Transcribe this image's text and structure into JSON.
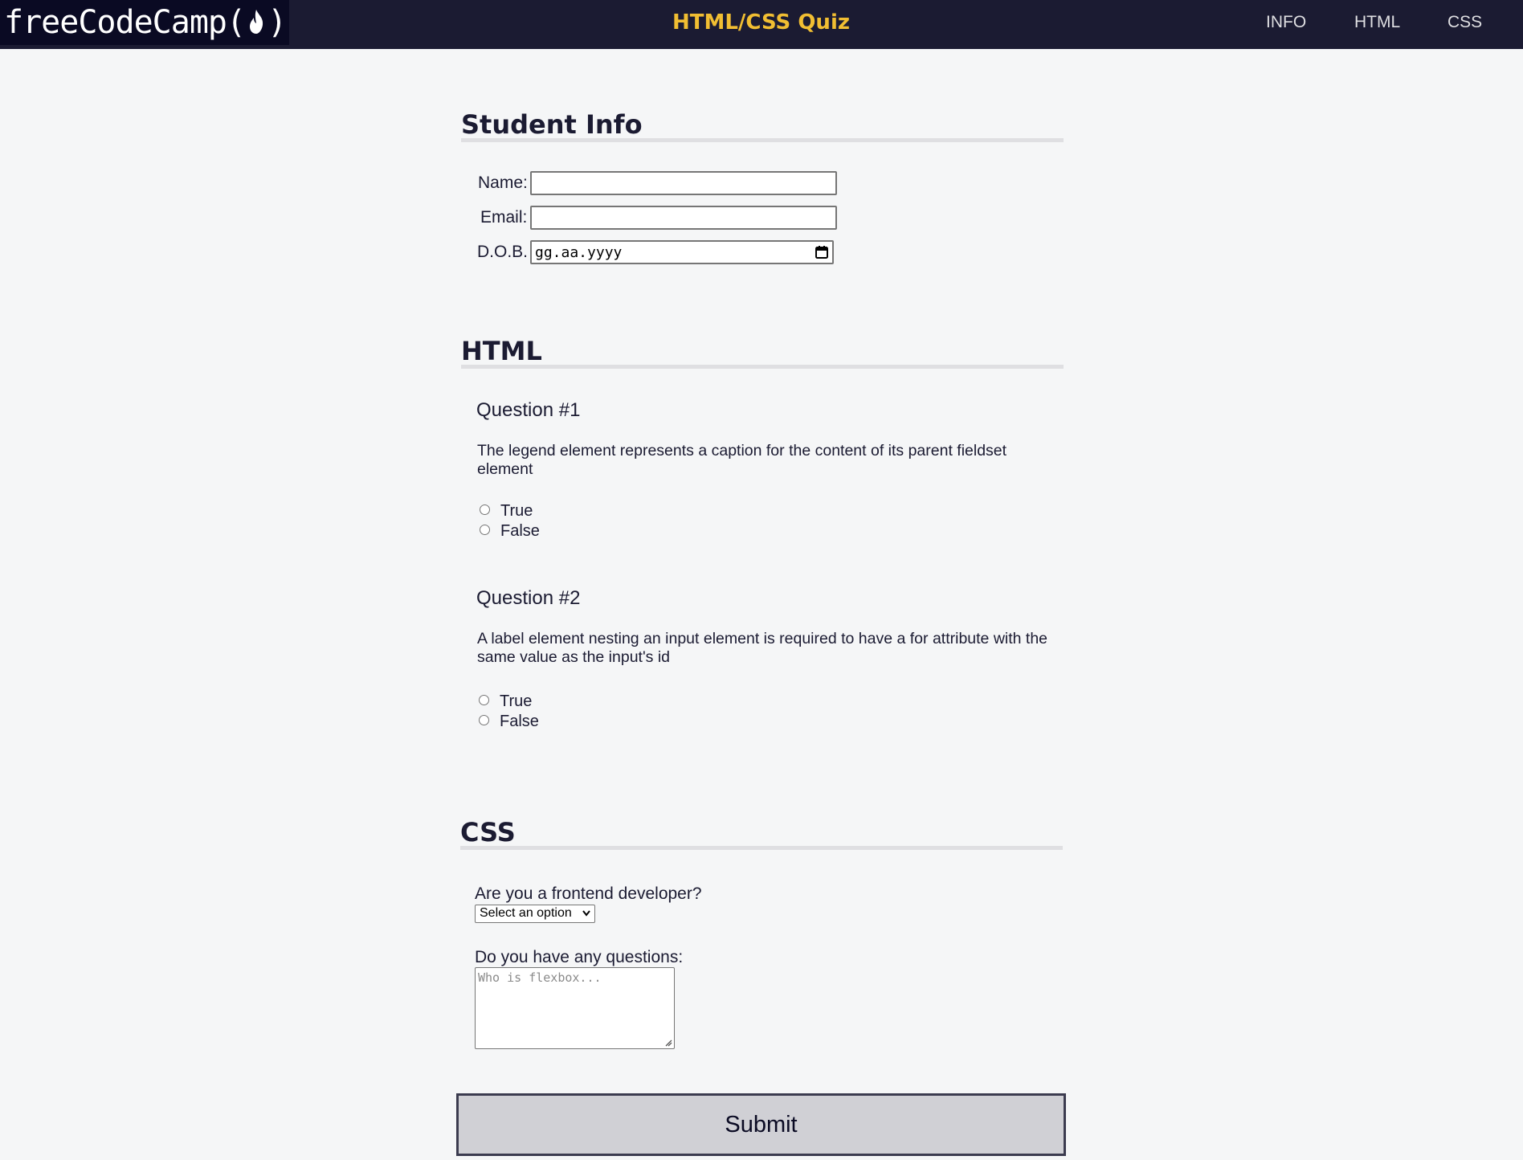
{
  "header": {
    "logo_text": "freeCodeCamp(",
    "logo_close": ")",
    "title": "HTML/CSS Quiz",
    "nav": [
      {
        "label": "INFO"
      },
      {
        "label": "HTML"
      },
      {
        "label": "CSS"
      }
    ]
  },
  "student_info": {
    "title": "Student Info",
    "name_label": "Name:",
    "name_value": "",
    "email_label": "Email:",
    "email_value": "",
    "dob_label": "D.O.B.",
    "dob_placeholder": "gg.aa.yyyy"
  },
  "html_section": {
    "title": "HTML",
    "questions": [
      {
        "title": "Question #1",
        "text": "The legend element represents a caption for the content of its parent fieldset element",
        "options": [
          "True",
          "False"
        ]
      },
      {
        "title": "Question #2",
        "text": "A label element nesting an input element is required to have a for attribute with the same value as the input's id",
        "options": [
          "True",
          "False"
        ]
      }
    ]
  },
  "css_section": {
    "title": "CSS",
    "frontend_label": "Are you a frontend developer?",
    "frontend_selected": "Select an option",
    "questions_label": "Do you have any questions:",
    "questions_placeholder": "Who is flexbox..."
  },
  "submit_label": "Submit",
  "colors": {
    "header_bg": "#1b1b32",
    "logo_bg": "#0a0a23",
    "title_accent": "#f1be32",
    "page_bg": "#f5f6f7",
    "button_bg": "#d0d0d5"
  }
}
